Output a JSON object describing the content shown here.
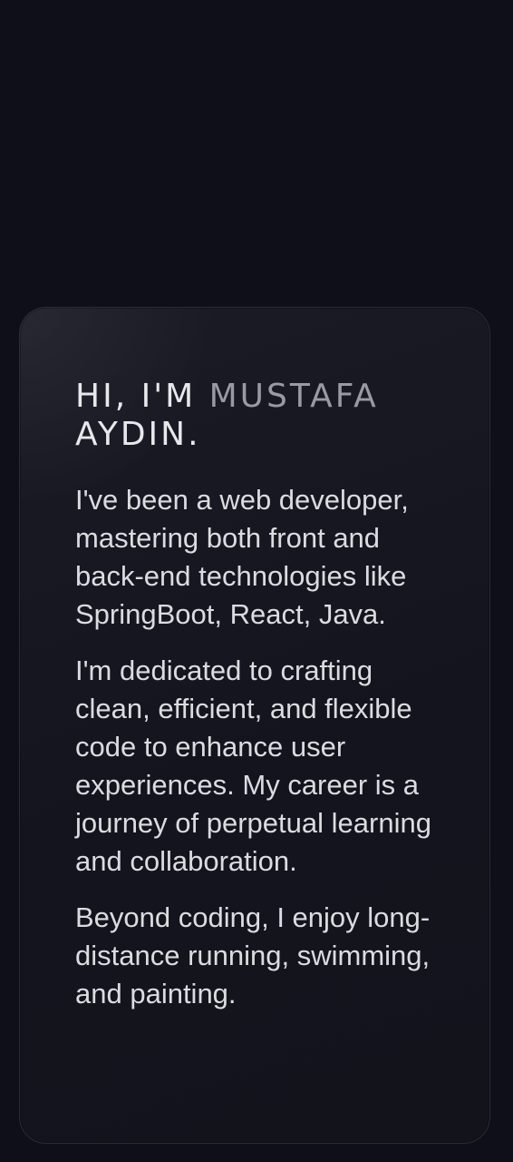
{
  "about": {
    "heading_prefix": "HI, I'M",
    "heading_first": "MUSTAFA",
    "heading_last": "AYDIN.",
    "paragraphs": [
      "I've been a web developer, mastering both front and back-end technologies like SpringBoot, React, Java.",
      "I'm dedicated to crafting clean, efficient, and flexible code to enhance user experiences. My career is a journey of perpetual learning and collaboration.",
      "Beyond coding, I enjoy long-distance running, swimming, and painting."
    ]
  },
  "colors": {
    "background": "#0f0f19",
    "card": "#171722",
    "heading_text": "#e8e8ec",
    "heading_accent": "#9a9aa2",
    "body_text": "#dcdce0"
  }
}
